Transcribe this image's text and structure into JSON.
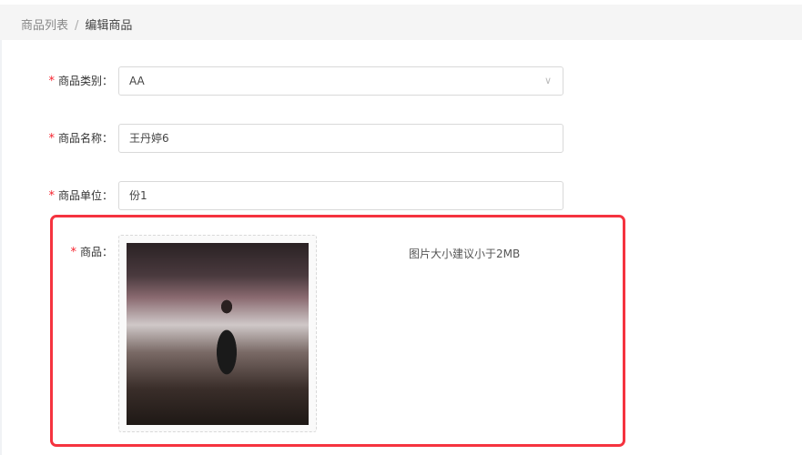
{
  "breadcrumb": {
    "items": [
      "商品列表",
      "编辑商品"
    ],
    "separator": "/"
  },
  "form": {
    "category": {
      "label": "商品类别",
      "value": "AA",
      "required": true
    },
    "name": {
      "label": "商品名称",
      "value": "王丹婷6",
      "required": true
    },
    "unit": {
      "label": "商品单位",
      "value": "份1",
      "required": true
    },
    "image": {
      "label": "商品",
      "required": true,
      "hint": "图片大小建议小于2MB"
    }
  },
  "colors": {
    "required_star": "#f5222d",
    "highlight": "#f5333f"
  }
}
